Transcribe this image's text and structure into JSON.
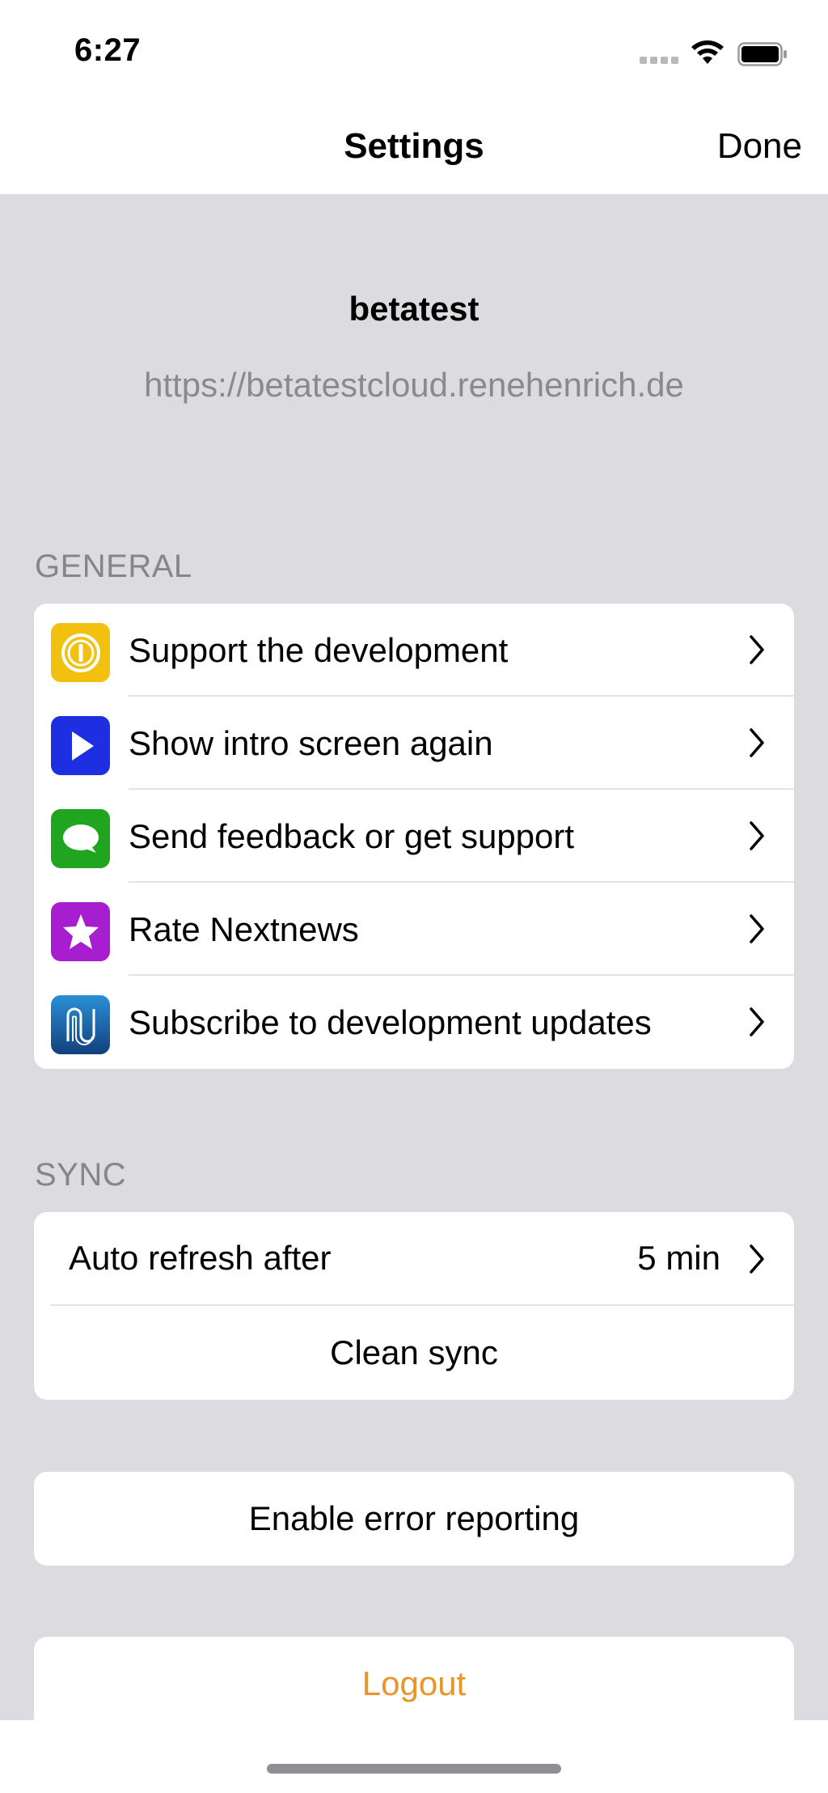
{
  "status_bar": {
    "time": "6:27"
  },
  "nav": {
    "title": "Settings",
    "done_label": "Done"
  },
  "account": {
    "name": "betatest",
    "url": "https://betatestcloud.renehenrich.de"
  },
  "general": {
    "header": "GENERAL",
    "items": [
      {
        "label": "Support the development",
        "icon": "coin-icon",
        "color": "#f2c10f"
      },
      {
        "label": "Show intro screen again",
        "icon": "play-icon",
        "color": "#1d2fe0"
      },
      {
        "label": "Send feedback or get support",
        "icon": "speech-bubble-icon",
        "color": "#1fa51f"
      },
      {
        "label": "Rate Nextnews",
        "icon": "star-icon",
        "color": "#a61ecf"
      },
      {
        "label": "Subscribe to development updates",
        "icon": "newsletter-icon",
        "color": "#1b6fb8"
      }
    ]
  },
  "sync": {
    "header": "SYNC",
    "auto_refresh_label": "Auto refresh after",
    "auto_refresh_value": "5 min",
    "clean_sync_label": "Clean sync"
  },
  "error_reporting": {
    "label": "Enable error reporting"
  },
  "logout": {
    "label": "Logout",
    "color": "#e8962c"
  }
}
